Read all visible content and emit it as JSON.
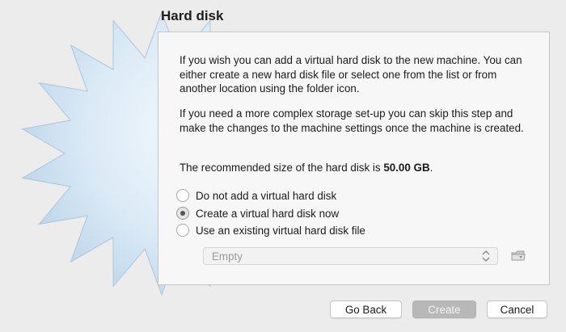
{
  "wizard": {
    "title": "Hard disk",
    "paragraph1": "If you wish you can add a virtual hard disk to the new machine. You can either create a new hard disk file or select one from the list or from another location using the folder icon.",
    "paragraph2": "If you need a more complex storage set-up you can skip this step and make the changes to the machine settings once the machine is created.",
    "recommended_prefix": "The recommended size of the hard disk is ",
    "recommended_size": "50.00 GB",
    "recommended_suffix": ".",
    "options": [
      {
        "label": "Do not add a virtual hard disk",
        "selected": false
      },
      {
        "label": "Create a virtual hard disk now",
        "selected": true
      },
      {
        "label": "Use an existing virtual hard disk file",
        "selected": false
      }
    ],
    "existing_disk_select": {
      "value": "Empty",
      "enabled": false
    },
    "folder_icon": "folder-icon"
  },
  "buttons": {
    "back": "Go Back",
    "create": "Create",
    "cancel": "Cancel"
  },
  "colors": {
    "background": "#ececec",
    "panel": "#f7f7f7",
    "starburst": "#c9dff0",
    "disabled_button": "#b8b8b8"
  }
}
